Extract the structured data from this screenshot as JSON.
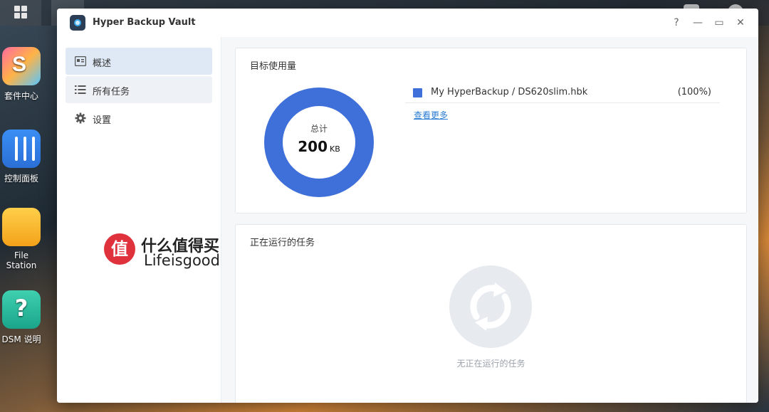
{
  "desktop": {
    "icons": [
      {
        "label": "套件中心",
        "icon": "package-center-icon"
      },
      {
        "label": "控制面板",
        "icon": "control-panel-icon"
      },
      {
        "label": "File Station",
        "icon": "folder-icon"
      },
      {
        "label": "DSM 说明",
        "icon": "help-icon"
      }
    ]
  },
  "window": {
    "title": "Hyper Backup Vault",
    "controls": {
      "help": "?",
      "minimize": "—",
      "maximize": "▭",
      "close": "✕"
    }
  },
  "sidebar": {
    "items": [
      {
        "label": "概述",
        "icon": "overview-icon",
        "active": true
      },
      {
        "label": "所有任务",
        "icon": "list-icon",
        "active": false
      },
      {
        "label": "设置",
        "icon": "gear-icon",
        "active": false
      }
    ]
  },
  "usage": {
    "title": "目标使用量",
    "total_caption": "总计",
    "total_value": "200",
    "total_unit": "KB",
    "accent_color": "#3f6fd8",
    "entries": [
      {
        "name": "My HyperBackup / DS620slim.hbk",
        "percent": "(100%)"
      }
    ],
    "more_link": "查看更多"
  },
  "running": {
    "title": "正在运行的任务",
    "empty_text": "无正在运行的任务"
  },
  "watermark": {
    "badge": "值",
    "line1": "什么值得买",
    "line2": "Lifeisgood",
    "corner": "值 什么值得买"
  }
}
